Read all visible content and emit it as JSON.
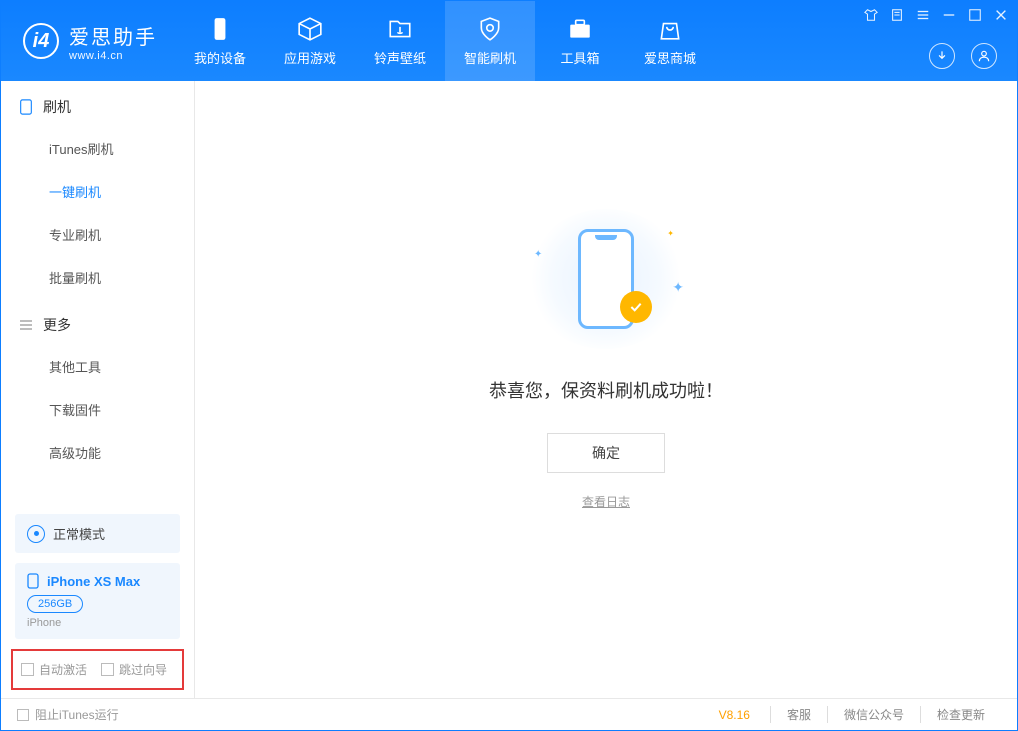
{
  "app": {
    "title": "爱思助手",
    "url": "www.i4.cn"
  },
  "tabs": [
    {
      "label": "我的设备"
    },
    {
      "label": "应用游戏"
    },
    {
      "label": "铃声壁纸"
    },
    {
      "label": "智能刷机"
    },
    {
      "label": "工具箱"
    },
    {
      "label": "爱思商城"
    }
  ],
  "sidebar": {
    "section1_title": "刷机",
    "section1_items": [
      "iTunes刷机",
      "一键刷机",
      "专业刷机",
      "批量刷机"
    ],
    "section2_title": "更多",
    "section2_items": [
      "其他工具",
      "下载固件",
      "高级功能"
    ]
  },
  "mode": {
    "label": "正常模式"
  },
  "device": {
    "name": "iPhone XS Max",
    "storage": "256GB",
    "type": "iPhone"
  },
  "highlight": {
    "opt1": "自动激活",
    "opt2": "跳过向导"
  },
  "main": {
    "success": "恭喜您，保资料刷机成功啦！",
    "ok": "确定",
    "view_log": "查看日志"
  },
  "footer": {
    "block_itunes": "阻止iTunes运行",
    "version": "V8.16",
    "links": [
      "客服",
      "微信公众号",
      "检查更新"
    ]
  }
}
